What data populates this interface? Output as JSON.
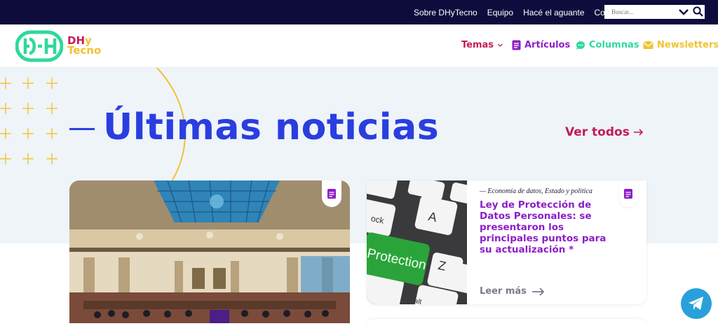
{
  "topbar": {
    "links": [
      "Sobre DHyTecno",
      "Equipo",
      "Hacé el aguante",
      "Contacto"
    ],
    "search_placeholder": "Buscar..."
  },
  "header": {
    "logo_line1": "DH",
    "logo_line1_y": "y",
    "logo_line2": "Tecno",
    "nav": {
      "temas": "Temas",
      "articulos": "Artículos",
      "columnas": "Columnas",
      "newsletters": "Newsletters"
    }
  },
  "hero": {
    "title": "Últimas noticias",
    "ver_todos": "Ver todos"
  },
  "cards": {
    "right": {
      "category": "— Economía de datos, Estado y política",
      "title": "Ley de Protección de Datos Personales: se presentaron los principales puntos para su actualización *",
      "leer_mas": "Leer más",
      "image_key_a": "A",
      "image_key_z": "Z",
      "image_key_lock": "ock",
      "image_key_protection": "Protection",
      "image_key_alt": "alt"
    }
  },
  "colors": {
    "topbar": "#0d0c3d",
    "primary_blue": "#2a3ee0",
    "magenta": "#c41a5a",
    "purple": "#8c1ec8",
    "green": "#2fd99a",
    "yellow": "#f2c230",
    "telegram": "#2aa0da"
  },
  "icons": [
    "chevron-down-icon",
    "search-icon",
    "document-icon",
    "chat-icon",
    "envelope-icon",
    "arrow-right-icon",
    "telegram-icon"
  ]
}
